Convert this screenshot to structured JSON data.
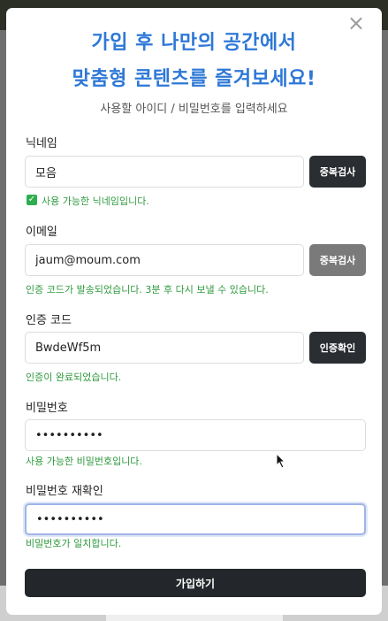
{
  "modal": {
    "close_icon": "×",
    "title_line1": "가입 후 나만의 공간에서",
    "title_line2": "맞춤형 콘텐츠를 즐겨보세요!",
    "subtitle": "사용할 아이디 / 비밀번호를 입력하세요"
  },
  "nickname": {
    "label": "닉네임",
    "value": "모음",
    "button": "중복검사",
    "message": "사용 가능한 닉네임입니다.",
    "check_icon": "✓"
  },
  "email": {
    "label": "이메일",
    "value": "jaum@moum.com",
    "button": "중복검사",
    "message": "인증 코드가 발송되었습니다. 3분 후 다시 보낼 수 있습니다."
  },
  "code": {
    "label": "인증 코드",
    "value": "BwdeWf5m",
    "button": "인증확인",
    "message": "인증이 완료되었습니다."
  },
  "password": {
    "label": "비밀번호",
    "value": "••••••••••",
    "message": "사용 가능한 비밀번호입니다."
  },
  "password_confirm": {
    "label": "비밀번호 재확인",
    "value": "••••••••••",
    "message": "비밀번호가 일치합니다."
  },
  "submit_label": "가입하기",
  "colors": {
    "title": "#2e78d7",
    "success": "#2e9a3e",
    "button": "#2a2d31"
  }
}
